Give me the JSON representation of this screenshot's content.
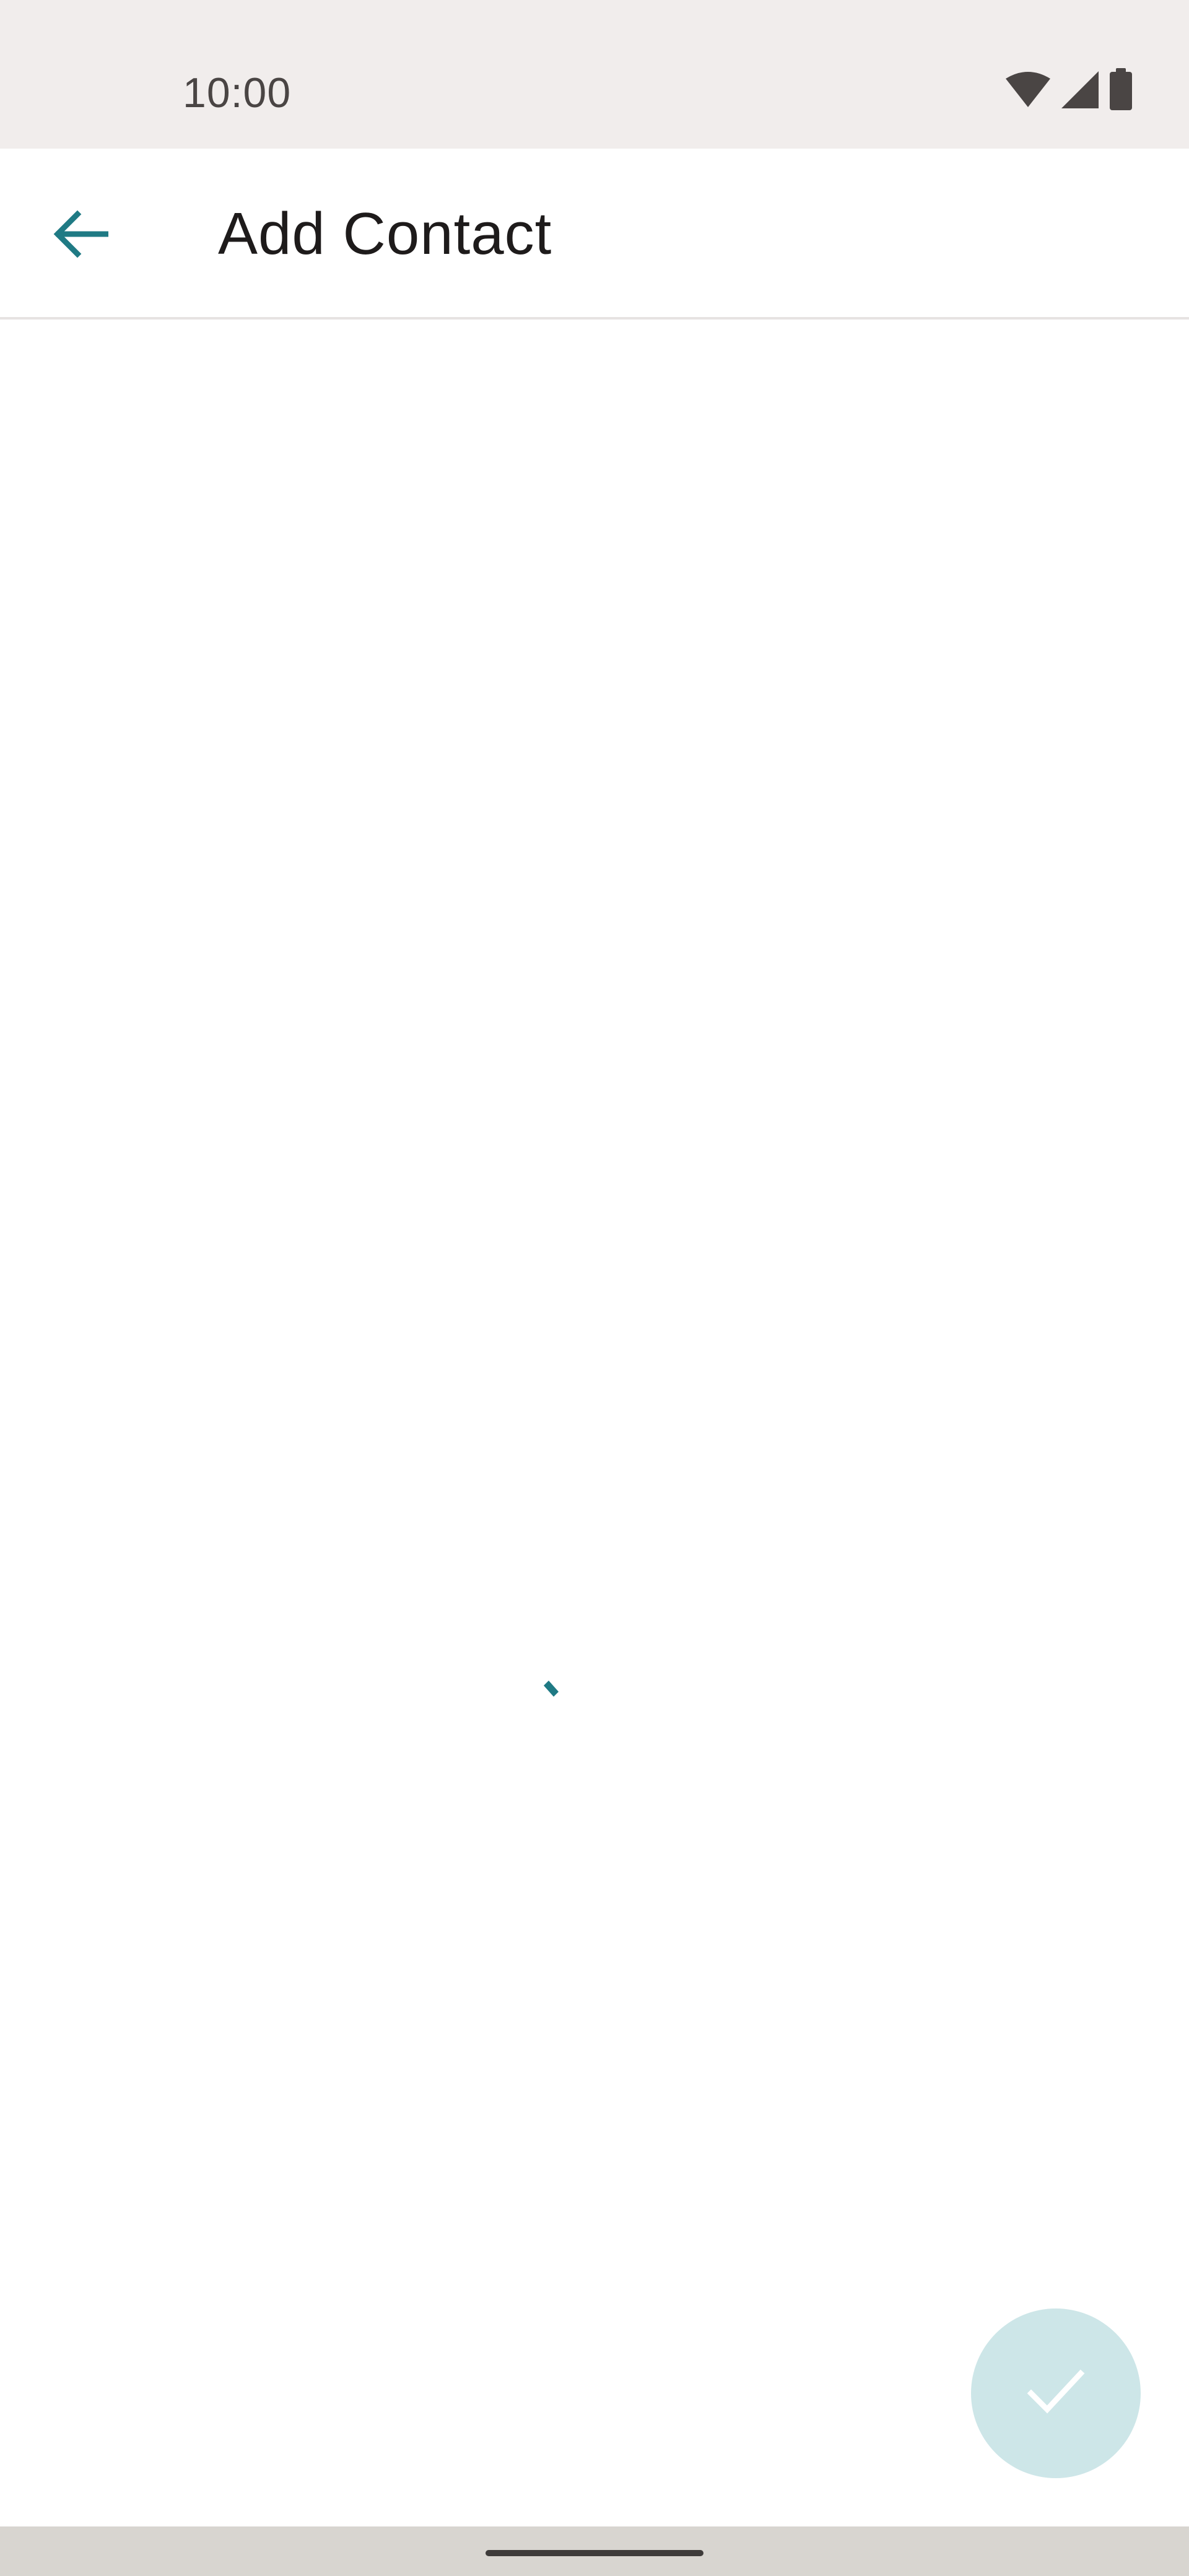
{
  "status_bar": {
    "time": "10:00",
    "icons": [
      "wifi-icon",
      "cellular-signal-icon",
      "battery-icon"
    ]
  },
  "app_bar": {
    "back_icon": "arrow-left-icon",
    "title": "Add Contact"
  },
  "content": {
    "state": "loading"
  },
  "fab": {
    "icon": "check-icon",
    "state": "disabled"
  },
  "colors": {
    "accent": "#1f7a84",
    "status_bar_bg": "#f1edec",
    "fab_bg": "#cde6e8",
    "title_text": "#1e1b1b",
    "nav_bar_bg": "#d8d5d0"
  }
}
